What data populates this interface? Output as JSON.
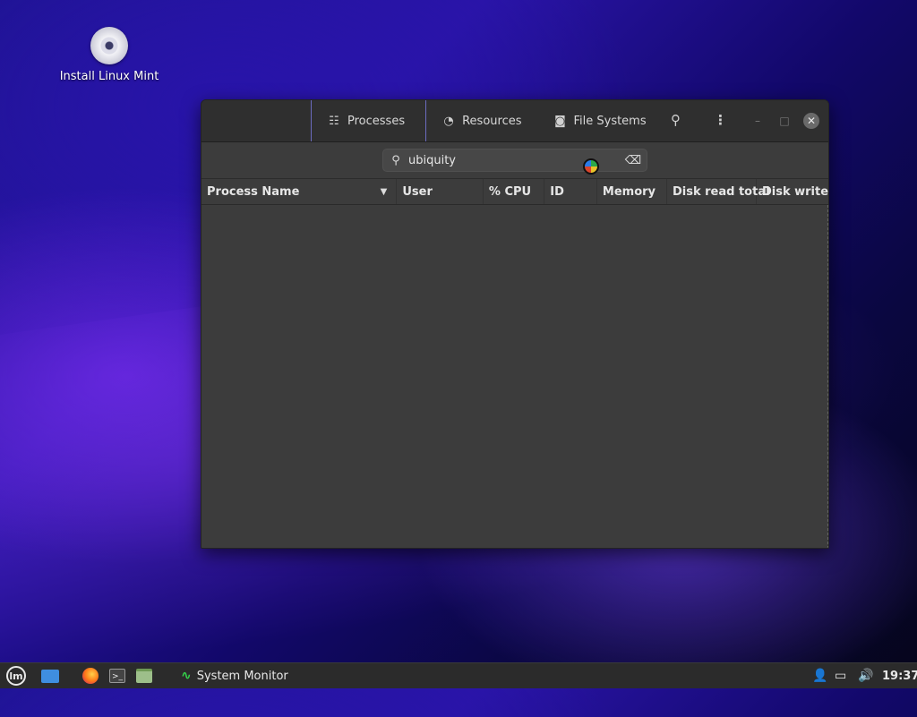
{
  "desktop": {
    "icon_label": "Install Linux Mint"
  },
  "window": {
    "tabs": [
      {
        "label": "Processes",
        "icon": "list-icon"
      },
      {
        "label": "Resources",
        "icon": "gauge-icon"
      },
      {
        "label": "File Systems",
        "icon": "disk-icon"
      }
    ],
    "search": {
      "value": "ubiquity"
    },
    "columns": [
      {
        "label": "Process Name"
      },
      {
        "label": "User"
      },
      {
        "label": "% CPU"
      },
      {
        "label": "ID"
      },
      {
        "label": "Memory"
      },
      {
        "label": "Disk read total"
      },
      {
        "label": "Disk write"
      }
    ],
    "rows": []
  },
  "taskbar": {
    "running_app_label": "System Monitor",
    "clock": "19:37"
  },
  "colors": {
    "accent": "#6c6cc0",
    "window_bg": "#3c3c3c",
    "headerbar_bg": "#2f2f2f"
  }
}
